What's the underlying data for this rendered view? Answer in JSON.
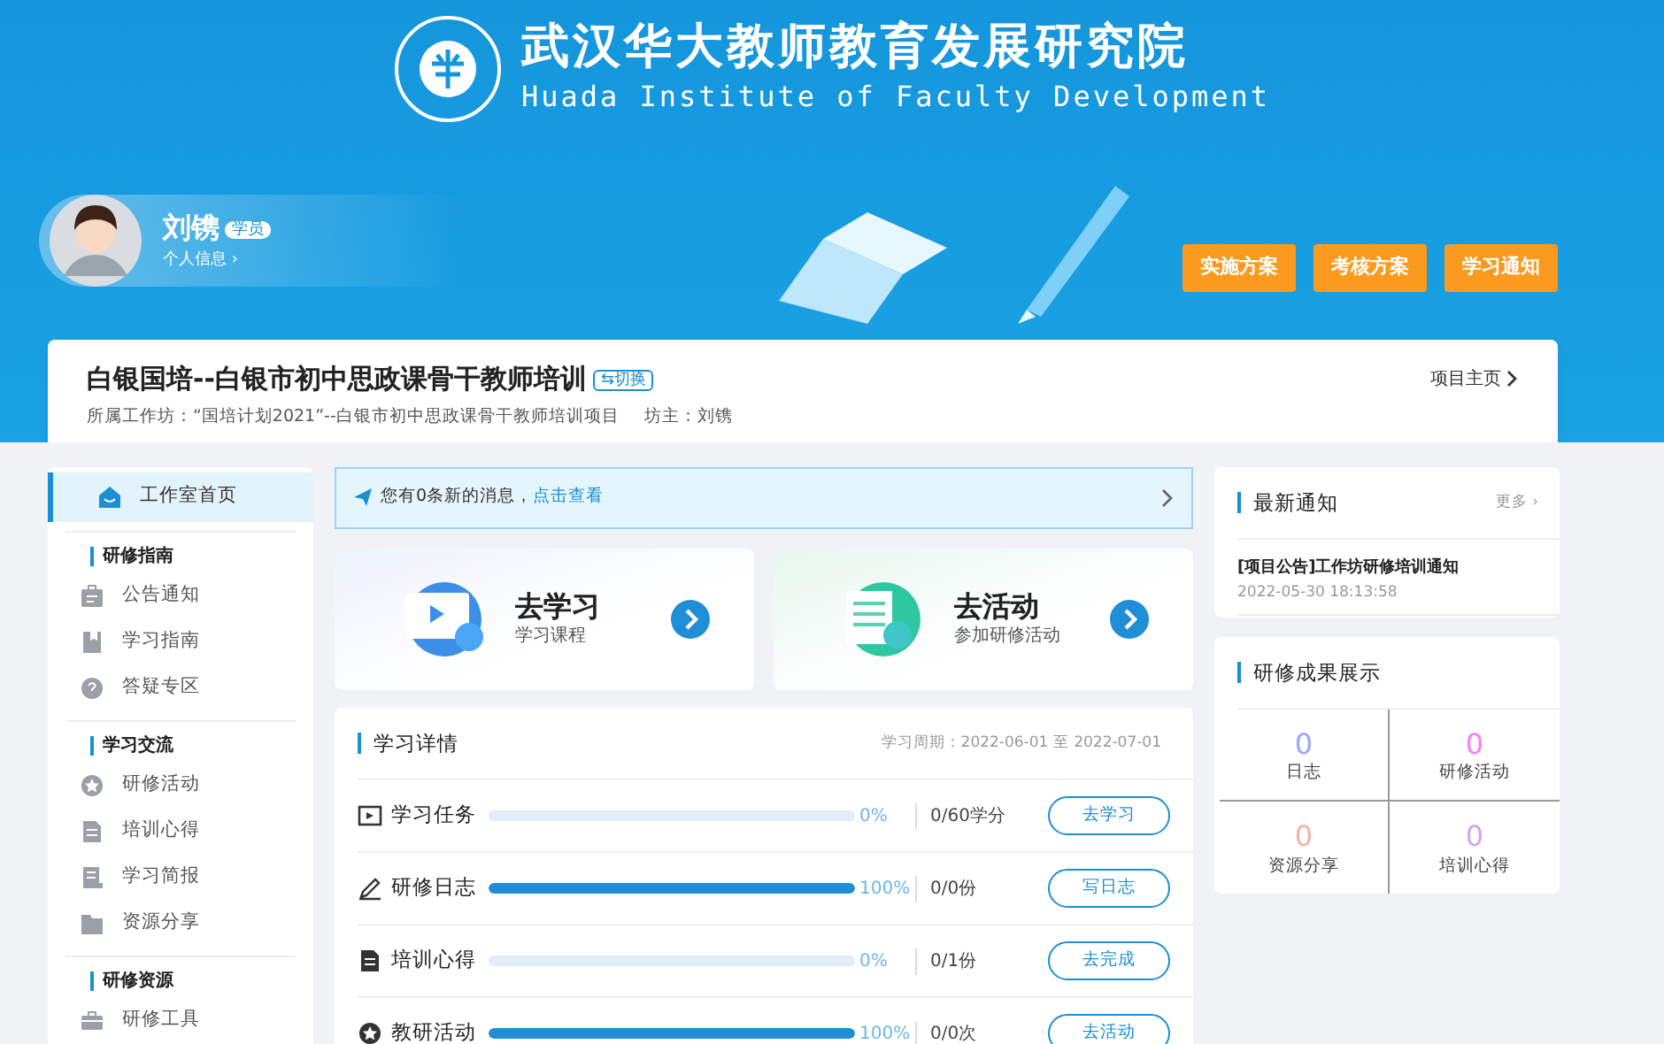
{
  "header": {
    "title": "武汉华大教师教育发展研究院",
    "subtitle": "Huada Institute of Faculty Development"
  },
  "user": {
    "name": "刘镌",
    "role": "学员",
    "profile_link": "个人信息 ›"
  },
  "header_buttons": [
    "实施方案",
    "考核方案",
    "学习通知"
  ],
  "project": {
    "title": "白银国培--白银市初中思政课骨干教师培训",
    "switch": "⇆切换",
    "workshop": "所属工作坊：“国培计划2021”--白银市初中思政课骨干教师培训项目",
    "host": "坊主：刘镌",
    "home_link": "项目主页"
  },
  "sidebar": {
    "items": [
      {
        "label": "工作室首页",
        "selected": true
      }
    ],
    "groups": [
      {
        "title": "研修指南",
        "items": [
          {
            "label": "公告通知",
            "selected": false
          },
          {
            "label": "学习指南",
            "selected": false
          },
          {
            "label": "答疑专区",
            "selected": false
          }
        ]
      },
      {
        "title": "学习交流",
        "items": [
          {
            "label": "研修活动",
            "selected": false
          },
          {
            "label": "培训心得",
            "selected": false
          },
          {
            "label": "学习简报",
            "selected": false
          },
          {
            "label": "资源分享",
            "selected": false
          }
        ]
      },
      {
        "title": "研修资源",
        "items": [
          {
            "label": "研修工具",
            "selected": false
          }
        ]
      }
    ]
  },
  "message_bar": {
    "text": "您有0条新的消息，",
    "link": "点击查看"
  },
  "shortcuts": [
    {
      "title": "去学习",
      "subtitle": "学习课程",
      "kind": "study"
    },
    {
      "title": "去活动",
      "subtitle": "参加研修活动",
      "kind": "activity"
    }
  ],
  "study_details": {
    "title": "学习详情",
    "period": "学习周期：2022-06-01 至 2022-07-01",
    "rows": [
      {
        "label": "学习任务",
        "level": 0,
        "percent": "0%",
        "count": "0/60学分",
        "button": "去学习"
      },
      {
        "label": "研修日志",
        "level": 1,
        "percent": "100%",
        "count": "0/0份",
        "button": "写日志"
      },
      {
        "label": "培训心得",
        "level": 0,
        "percent": "0%",
        "count": "0/1份",
        "button": "去完成"
      },
      {
        "label": "教研活动",
        "level": 1,
        "percent": "100%",
        "count": "0/0次",
        "button": "去活动"
      }
    ]
  },
  "notices": {
    "title": "最新通知",
    "more": "更多 ›",
    "items": [
      {
        "title": "[项目公告]工作坊研修培训通知",
        "time": "2022-05-30 18:13:58"
      }
    ]
  },
  "achievements": {
    "title": "研修成果展示",
    "stats": [
      {
        "value": "0",
        "label": "日志",
        "color": "#9aa6ff"
      },
      {
        "value": "0",
        "label": "研修活动",
        "color": "#ff7df5"
      },
      {
        "value": "0",
        "label": "资源分享",
        "color": "#f4b4a4"
      },
      {
        "value": "0",
        "label": "培训心得",
        "color": "#d4a6ec"
      }
    ]
  }
}
